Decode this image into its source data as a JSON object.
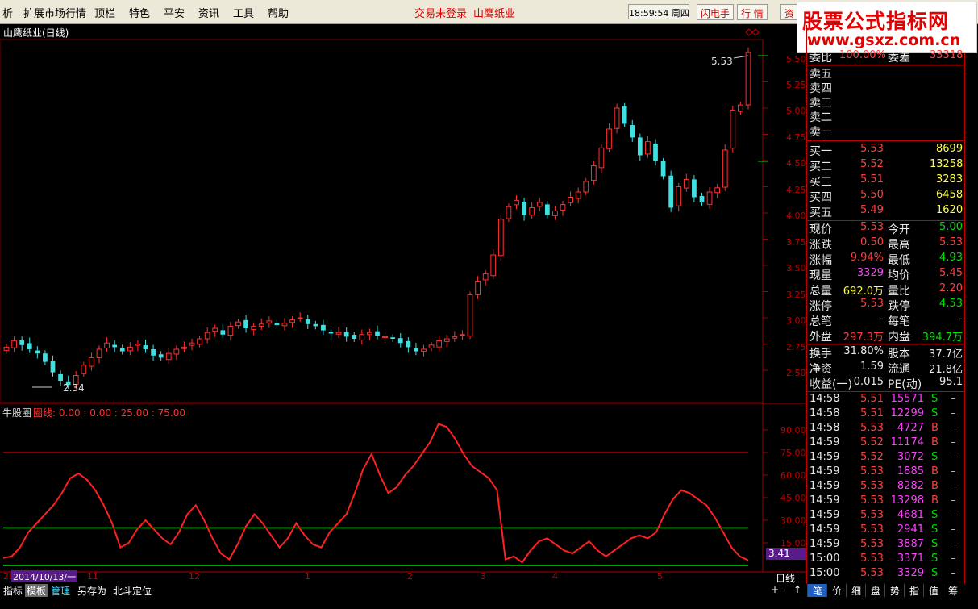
{
  "menubar": {
    "items": [
      "析",
      "扩展市场行情",
      "顶栏",
      "特色",
      "平安",
      "资讯",
      "工具",
      "帮助"
    ],
    "alerts": [
      "交易未登录",
      "山鹰纸业"
    ],
    "clock": "18:59:54 周四",
    "buttons": [
      "闪电手",
      "行 情",
      "资"
    ]
  },
  "watermark": {
    "line1": "股票公式指标网",
    "line2": "www.gsxz.com.cn"
  },
  "chart": {
    "title": "山鹰纸业(日线)",
    "price_labels": [
      "5.50",
      "5.25",
      "5.00",
      "4.75",
      "4.50",
      "4.25",
      "4.00",
      "3.75",
      "3.50",
      "3.25",
      "3.00",
      "2.75",
      "2.50"
    ],
    "high_marker": "5.53",
    "low_marker": "2.34",
    "indicator_name": "牛股圈",
    "indicator_legend": "圈线: 0.00 : 0.00 : 25.00 : 75.00",
    "ind_labels": [
      "90.00",
      "75.00",
      "60.00",
      "45.00",
      "30.00",
      "15.00"
    ],
    "ind_current": "3.41",
    "date_cursor": "2014/10/13/一",
    "month_ticks": [
      "20",
      "11",
      "12",
      "1",
      "2",
      "3",
      "4",
      "5"
    ],
    "period": "日线",
    "colors": {
      "up": "#ff3030",
      "down": "#40e0e0",
      "line": "#ff2020",
      "hline_green": "#00e000",
      "hline_red": "#d00000"
    }
  },
  "chart_data": [
    {
      "type": "candlestick",
      "title": "山鹰纸业(日线)",
      "ylim": [
        2.34,
        5.53
      ],
      "high": 5.53,
      "low": 2.34,
      "close_series": [
        2.72,
        2.78,
        2.74,
        2.7,
        2.66,
        2.58,
        2.48,
        2.4,
        2.36,
        2.45,
        2.55,
        2.62,
        2.7,
        2.76,
        2.72,
        2.68,
        2.72,
        2.75,
        2.7,
        2.64,
        2.62,
        2.66,
        2.7,
        2.72,
        2.76,
        2.8,
        2.86,
        2.9,
        2.84,
        2.92,
        2.96,
        2.9,
        2.92,
        2.94,
        2.97,
        2.93,
        2.95,
        2.98,
        3.0,
        2.94,
        2.92,
        2.88,
        2.85,
        2.86,
        2.82,
        2.8,
        2.84,
        2.86,
        2.83,
        2.82,
        2.8,
        2.76,
        2.72,
        2.68,
        2.7,
        2.74,
        2.78,
        2.8,
        2.82,
        2.84,
        3.22,
        3.35,
        3.42,
        3.6,
        3.94,
        4.06,
        4.12,
        3.98,
        4.05,
        4.1,
        3.98,
        4.02,
        4.08,
        4.15,
        4.2,
        4.3,
        4.45,
        4.62,
        4.8,
        5.0,
        4.85,
        4.72,
        4.55,
        4.68,
        4.5,
        4.35,
        4.05,
        4.25,
        4.32,
        4.15,
        4.1,
        4.2,
        4.24,
        4.6,
        4.98,
        5.03,
        5.53
      ]
    },
    {
      "type": "line",
      "name": "牛股圈",
      "ylim": [
        0,
        100
      ],
      "hlines": [
        0,
        25,
        75
      ],
      "values": [
        5,
        6,
        12,
        22,
        28,
        34,
        40,
        48,
        58,
        61,
        57,
        50,
        40,
        28,
        12,
        15,
        24,
        30,
        24,
        18,
        14,
        22,
        34,
        40,
        30,
        18,
        8,
        4,
        14,
        26,
        34,
        28,
        20,
        12,
        18,
        28,
        20,
        14,
        12,
        22,
        28,
        34,
        48,
        64,
        74,
        60,
        48,
        52,
        60,
        66,
        74,
        82,
        94,
        92,
        84,
        74,
        66,
        62,
        58,
        50,
        4,
        6,
        2,
        10,
        16,
        18,
        14,
        10,
        8,
        12,
        16,
        10,
        6,
        10,
        14,
        18,
        20,
        18,
        22,
        34,
        44,
        50,
        48,
        44,
        40,
        32,
        22,
        12,
        6,
        3.41
      ]
    }
  ],
  "quote": {
    "weibi": {
      "label": "委比",
      "value": "100.00%",
      "label2": "委差",
      "value2": "33318"
    },
    "sells": [
      {
        "label": "卖五",
        "price": "",
        "vol": ""
      },
      {
        "label": "卖四",
        "price": "",
        "vol": ""
      },
      {
        "label": "卖三",
        "price": "",
        "vol": ""
      },
      {
        "label": "卖二",
        "price": "",
        "vol": ""
      },
      {
        "label": "卖一",
        "price": "",
        "vol": ""
      }
    ],
    "buys": [
      {
        "label": "买一",
        "price": "5.53",
        "vol": "8699"
      },
      {
        "label": "买二",
        "price": "5.52",
        "vol": "13258"
      },
      {
        "label": "买三",
        "price": "5.51",
        "vol": "3283"
      },
      {
        "label": "买四",
        "price": "5.50",
        "vol": "6458"
      },
      {
        "label": "买五",
        "price": "5.49",
        "vol": "1620"
      }
    ],
    "stats": [
      {
        "l1": "现价",
        "v1": "5.53",
        "c1": "red",
        "l2": "今开",
        "v2": "5.00",
        "c2": "green"
      },
      {
        "l1": "涨跌",
        "v1": "0.50",
        "c1": "red",
        "l2": "最高",
        "v2": "5.53",
        "c2": "red"
      },
      {
        "l1": "涨幅",
        "v1": "9.94%",
        "c1": "red",
        "l2": "最低",
        "v2": "4.93",
        "c2": "green"
      },
      {
        "l1": "现量",
        "v1": "3329",
        "c1": "magenta",
        "l2": "均价",
        "v2": "5.45",
        "c2": "red"
      },
      {
        "l1": "总量",
        "v1": "692.0万",
        "c1": "yellow",
        "l2": "量比",
        "v2": "2.20",
        "c2": "red"
      },
      {
        "l1": "涨停",
        "v1": "5.53",
        "c1": "red",
        "l2": "跌停",
        "v2": "4.53",
        "c2": "green"
      },
      {
        "l1": "总笔",
        "v1": "-",
        "c1": "white",
        "l2": "每笔",
        "v2": "-",
        "c2": "white"
      },
      {
        "l1": "外盘",
        "v1": "297.3万",
        "c1": "red",
        "l2": "内盘",
        "v2": "394.7万",
        "c2": "green"
      }
    ],
    "stats2": [
      {
        "l1": "换手",
        "v1": "31.80%",
        "c1": "white",
        "l2": "股本",
        "v2": "37.7亿",
        "c2": "white"
      },
      {
        "l1": "净资",
        "v1": "1.59",
        "c1": "white",
        "l2": "流通",
        "v2": "21.8亿",
        "c2": "white"
      },
      {
        "l1": "收益(一)",
        "v1": "0.015",
        "c1": "white",
        "l2": "PE(动)",
        "v2": "95.1",
        "c2": "white"
      }
    ],
    "ticks": [
      {
        "t": "14:58",
        "p": "5.51",
        "v": "15571",
        "bs": "S"
      },
      {
        "t": "14:58",
        "p": "5.51",
        "v": "12299",
        "bs": "S"
      },
      {
        "t": "14:58",
        "p": "5.53",
        "v": "4727",
        "bs": "B"
      },
      {
        "t": "14:59",
        "p": "5.52",
        "v": "11174",
        "bs": "B"
      },
      {
        "t": "14:59",
        "p": "5.52",
        "v": "3072",
        "bs": "S"
      },
      {
        "t": "14:59",
        "p": "5.53",
        "v": "1885",
        "bs": "B"
      },
      {
        "t": "14:59",
        "p": "5.53",
        "v": "8282",
        "bs": "B"
      },
      {
        "t": "14:59",
        "p": "5.53",
        "v": "13298",
        "bs": "B"
      },
      {
        "t": "14:59",
        "p": "5.53",
        "v": "4681",
        "bs": "S"
      },
      {
        "t": "14:59",
        "p": "5.53",
        "v": "2941",
        "bs": "S"
      },
      {
        "t": "14:59",
        "p": "5.53",
        "v": "3887",
        "bs": "S"
      },
      {
        "t": "15:00",
        "p": "5.53",
        "v": "3371",
        "bs": "S"
      },
      {
        "t": "15:00",
        "p": "5.53",
        "v": "3329",
        "bs": "S"
      }
    ],
    "tick_dash": "–"
  },
  "bottom": {
    "tabs": [
      "指标",
      "模板",
      "管理",
      "另存为",
      "北斗定位"
    ],
    "arrows": [
      "+",
      "-",
      "↑"
    ],
    "rtabs": [
      "笔",
      "价",
      "细",
      "盘",
      "势",
      "指",
      "值",
      "筹"
    ]
  }
}
